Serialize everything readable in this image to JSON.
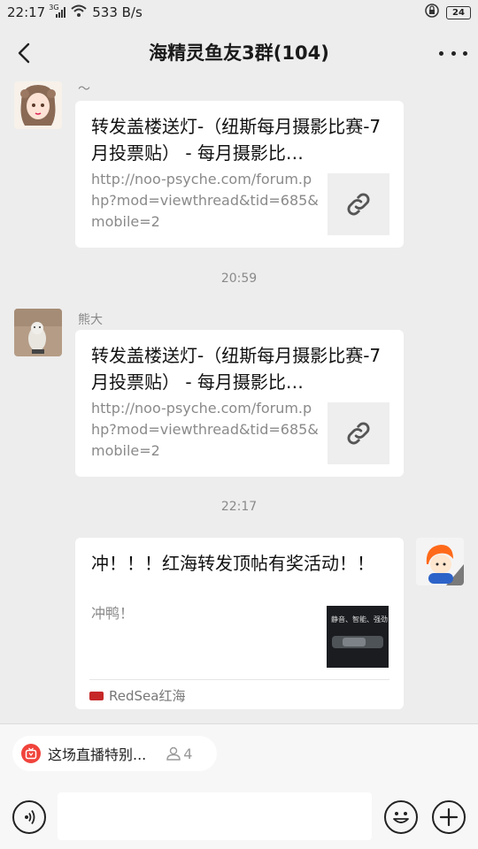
{
  "status_bar": {
    "time": "22:17",
    "network_type": "3G",
    "speed": "533 B/s",
    "battery": "24"
  },
  "header": {
    "title": "海精灵鱼友3群(104)"
  },
  "messages": [
    {
      "sender": "〜",
      "title": "转发盖楼送灯-（纽斯每月摄影比赛-7月投票贴） - 每月摄影比…",
      "description": "http://noo-psyche.com/forum.php?mod=viewthread&tid=685&mobile=2"
    },
    {
      "timestamp": "20:59"
    },
    {
      "sender": "熊大",
      "title": "转发盖楼送灯-（纽斯每月摄影比赛-7月投票贴） - 每月摄影比…",
      "description": "http://noo-psyche.com/forum.php?mod=viewthread&tid=685&mobile=2"
    },
    {
      "timestamp": "22:17"
    },
    {
      "title": "冲！！！红海转发顶帖有奖活动！！",
      "description": "冲鸭！",
      "thumb_text": "静音、智能、强劲",
      "source": "RedSea红海"
    }
  ],
  "live_chip": {
    "label": "这场直播特别...",
    "viewers": "4"
  },
  "input": {
    "value": ""
  },
  "colors": {
    "chat_background": "#ededed",
    "live_red": "#f0433b"
  },
  "icons": [
    "back-arrow-icon",
    "more-dots-icon",
    "link-icon",
    "live-tv-icon",
    "person-icon",
    "voice-icon",
    "emoji-icon",
    "plus-icon"
  ]
}
